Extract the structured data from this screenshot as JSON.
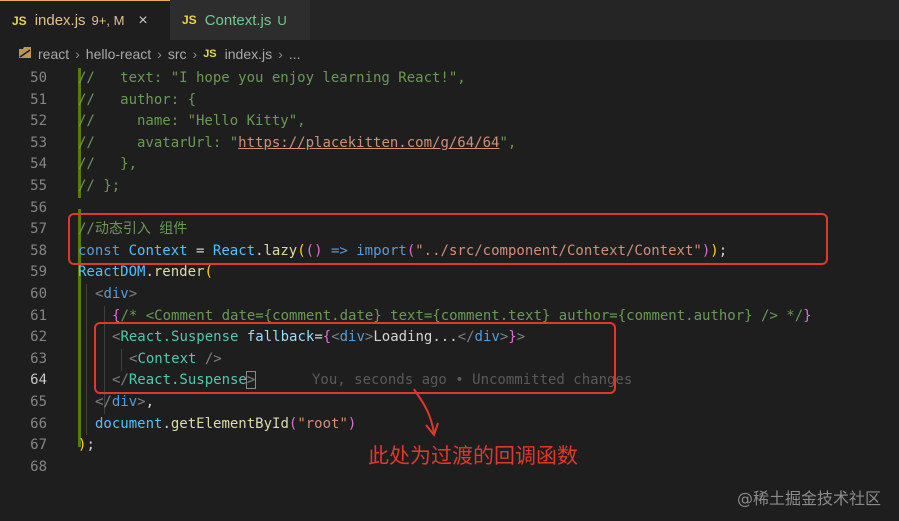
{
  "tabs": [
    {
      "icon": "JS",
      "name": "index.js",
      "badge": "9+, M",
      "close": "×"
    },
    {
      "icon": "JS",
      "name": "Context.js",
      "badge": "U"
    }
  ],
  "breadcrumb": {
    "items": [
      "react",
      "hello-react",
      "src"
    ],
    "file_icon": "JS",
    "file": "index.js",
    "tail": "..."
  },
  "lines": {
    "n50": "50",
    "n51": "51",
    "n52": "52",
    "n53": "53",
    "n54": "54",
    "n55": "55",
    "n56": "56",
    "n57": "57",
    "n58": "58",
    "n59": "59",
    "n60": "60",
    "n61": "61",
    "n62": "62",
    "n63": "63",
    "n64": "64",
    "n65": "65",
    "n66": "66",
    "n67": "67",
    "n68": "68"
  },
  "code": {
    "l50": "//   text: \"I hope you enjoy learning React!\",",
    "l51": "//   author: {",
    "l52a": "//     name: \"Hello Kitty\",",
    "l53a": "//     avatarUrl: \"",
    "l53b": "https://placekitten.com/g/64/64",
    "l53c": "\",",
    "l54": "//   },",
    "l55": "// };",
    "l57": "//动态引入 组件",
    "l58_kw": "const",
    "l58_var": "Context",
    "l58_eq": " = ",
    "l58_obj": "React",
    "l58_dot": ".",
    "l58_fn": "lazy",
    "l58_p1": "(",
    "l58_p2": "()",
    "l58_arrow": " => ",
    "l58_imp": "import",
    "l58_p3": "(",
    "l58_str": "\"../src/component/Context/Context\"",
    "l58_p4": ")",
    "l58_p5": ")",
    "l58_semi": ";",
    "l59_obj": "ReactDOM",
    "l59_dot": ".",
    "l59_fn": "render",
    "l59_p": "(",
    "l60_open": "<",
    "l60_tag": "div",
    "l60_close": ">",
    "l61_b1": "{",
    "l61_cm": "/* <Comment date={comment.date} text={comment.text} author={comment.author} /> */",
    "l61_b2": "}",
    "l62_lt": "<",
    "l62_cmp": "React.Suspense",
    "l62_attr": " fallback",
    "l62_eq": "=",
    "l62_b1": "{",
    "l62_lt2": "<",
    "l62_div": "div",
    "l62_gt2": ">",
    "l62_text": "Loading...",
    "l62_lt3": "</",
    "l62_div2": "div",
    "l62_gt3": ">",
    "l62_b2": "}",
    "l62_gt": ">",
    "l63_lt": "<",
    "l63_cmp": "Context",
    "l63_end": " />",
    "l64_lt": "</",
    "l64_cmp": "React.Suspense",
    "l64_gt": ">",
    "l64_blame": "You, seconds ago • Uncommitted changes",
    "l65_lt": "</",
    "l65_tag": "div",
    "l65_gt": ">",
    "l65_comma": ",",
    "l66_fn1": "document",
    "l66_dot": ".",
    "l66_fn2": "getElementById",
    "l66_p1": "(",
    "l66_str": "\"root\"",
    "l66_p2": ")",
    "l67_p": ")",
    "l67_semi": ";"
  },
  "annotation": {
    "text": "此处为过渡的回调函数",
    "color": "#e0382b"
  },
  "watermark": "@稀土掘金技术社区",
  "colors": {
    "background": "#1e1e1e",
    "comment": "#6a9955",
    "keyword": "#569cd6",
    "string": "#ce9178",
    "component": "#4ec9b0"
  }
}
